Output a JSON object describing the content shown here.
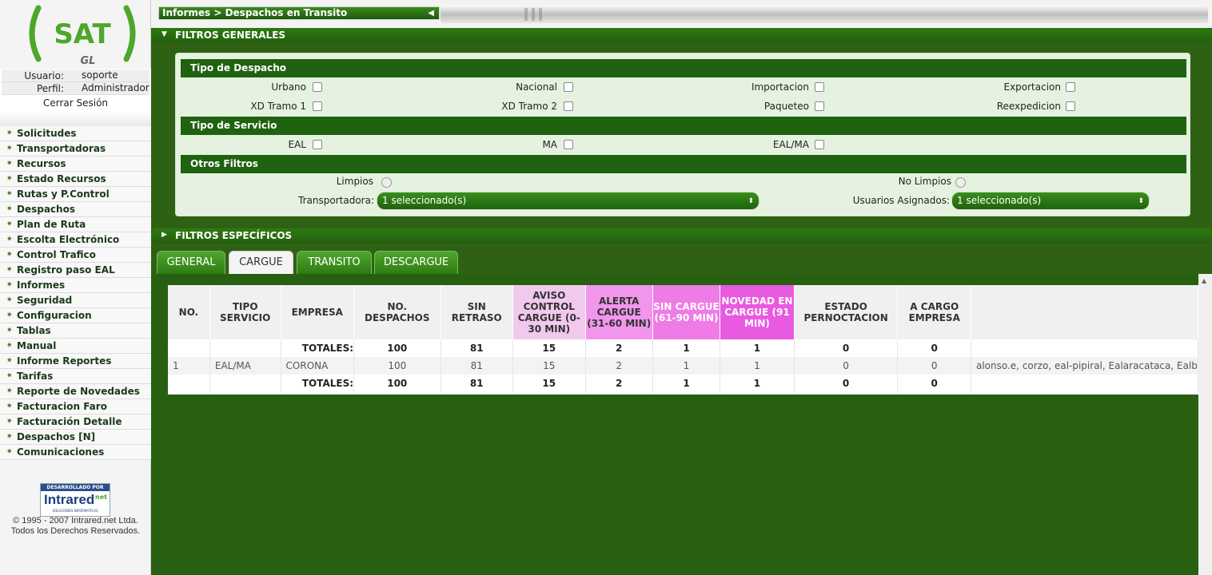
{
  "sidebar": {
    "logo_text": "SAT",
    "logo_sub": "GL",
    "usuario_label": "Usuario:",
    "usuario_value": "soporte",
    "perfil_label": "Perfil:",
    "perfil_value": "Administrador",
    "logout": "Cerrar Sesión",
    "menu": [
      "Solicitudes",
      "Transportadoras",
      "Recursos",
      "Estado Recursos",
      "Rutas y P.Control",
      "Despachos",
      "Plan de Ruta",
      "Escolta Electrónico",
      "Control Trafico",
      "Registro paso EAL",
      "Informes",
      "Seguridad",
      "Configuracion",
      "Tablas",
      "Manual",
      "Informe Reportes",
      "Tarifas",
      "Reporte de Novedades",
      "Facturacion Faro",
      "Facturación Detalle",
      "Despachos [N]",
      "Comunicaciones"
    ],
    "dev_top": "DESARROLLADO POR",
    "dev_brand": "Intrared",
    "dev_net": "net",
    "dev_bottom": "SOLUCIONES INFORMATICAS",
    "copyright_1": "© 1995 - 2007 Intrared.net Ltda.",
    "copyright_2": "Todos los Derechos Reservados."
  },
  "breadcrumb": "Informes > Despachos en Transito",
  "filtros_generales": {
    "title": "FILTROS GENERALES",
    "tipo_despacho_title": "Tipo de Despacho",
    "tipo_despacho": [
      "Urbano",
      "Nacional",
      "Importacion",
      "Exportacion",
      "XD Tramo 1",
      "XD Tramo 2",
      "Paqueteo",
      "Reexpedicion"
    ],
    "tipo_servicio_title": "Tipo de Servicio",
    "tipo_servicio": [
      "EAL",
      "MA",
      "EAL/MA"
    ],
    "otros_title": "Otros Filtros",
    "limpios": "Limpios",
    "no_limpios": "No Limpios",
    "transportadora_label": "Transportadora:",
    "transportadora_value": "1 seleccionado(s)",
    "usuarios_label": "Usuarios Asignados:",
    "usuarios_value": "1 seleccionado(s)"
  },
  "filtros_especificos": {
    "title": "FILTROS ESPECÍFICOS"
  },
  "tabs": [
    "GENERAL",
    "CARGUE",
    "TRANSITO",
    "DESCARGUE"
  ],
  "active_tab": "CARGUE",
  "table": {
    "headers": [
      {
        "label": "NO.",
        "bg": "#f0f0f0",
        "color": "#333333"
      },
      {
        "label": "TIPO SERVICIO",
        "bg": "#f0f0f0",
        "color": "#333333"
      },
      {
        "label": "EMPRESA",
        "bg": "#f0f0f0",
        "color": "#333333"
      },
      {
        "label": "NO. DESPACHOS",
        "bg": "#f0f0f0",
        "color": "#333333"
      },
      {
        "label": "SIN RETRASO",
        "bg": "#f0f0f0",
        "color": "#333333"
      },
      {
        "label": "AVISO CONTROL CARGUE (0-30 MIN)",
        "bg": "#f1c9ec",
        "color": "#333333"
      },
      {
        "label": "ALERTA CARGUE (31-60 MIN)",
        "bg": "#f196ec",
        "color": "#333333"
      },
      {
        "label": "SIN CARGUE (61-90 MIN)",
        "bg": "#ee7be6",
        "color": "#ffffff"
      },
      {
        "label": "NOVEDAD EN CARGUE (91 MIN)",
        "bg": "#e85ae0",
        "color": "#ffffff"
      },
      {
        "label": "ESTADO PERNOCTACION",
        "bg": "#f0f0f0",
        "color": "#333333"
      },
      {
        "label": "A CARGO EMPRESA",
        "bg": "#f0f0f0",
        "color": "#333333"
      },
      {
        "label": "",
        "bg": "#f0f0f0",
        "color": "#333333"
      }
    ],
    "totales_top": [
      "",
      "",
      "TOTALES:",
      "100",
      "81",
      "15",
      "2",
      "1",
      "1",
      "0",
      "0",
      ""
    ],
    "rows": [
      [
        "1",
        "EAL/MA",
        "CORONA",
        "100",
        "81",
        "15",
        "2",
        "1",
        "1",
        "0",
        "0",
        "alonso.e, corzo, eal-pipiral, Ealaracataca, Ealb"
      ]
    ],
    "totales_bottom": [
      "",
      "",
      "TOTALES:",
      "100",
      "81",
      "15",
      "2",
      "1",
      "1",
      "0",
      "0",
      ""
    ]
  },
  "colors": {
    "green_dark": "#2f6114",
    "green_header": "#1f6210",
    "panel_bg": "#e6f2e0"
  }
}
